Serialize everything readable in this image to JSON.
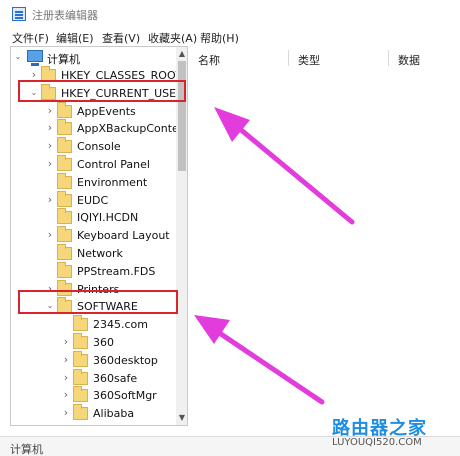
{
  "window": {
    "title": "注册表编辑器"
  },
  "menu": [
    "文件(F)",
    "编辑(E)",
    "查看(V)",
    "收藏夹(A)",
    "帮助(H)"
  ],
  "tree": {
    "root": "计算机",
    "items": [
      {
        "label": "HKEY_CLASSES_ROOT",
        "state": "collapsed",
        "level": 1
      },
      {
        "label": "HKEY_CURRENT_USER",
        "state": "expanded",
        "level": 1,
        "highlighted": true
      },
      {
        "label": "AppEvents",
        "state": "collapsed",
        "level": 2
      },
      {
        "label": "AppXBackupConter",
        "state": "collapsed",
        "level": 2
      },
      {
        "label": "Console",
        "state": "collapsed",
        "level": 2
      },
      {
        "label": "Control Panel",
        "state": "collapsed",
        "level": 2
      },
      {
        "label": "Environment",
        "state": "leaf",
        "level": 2
      },
      {
        "label": "EUDC",
        "state": "collapsed",
        "level": 2
      },
      {
        "label": "IQIYI.HCDN",
        "state": "leaf",
        "level": 2
      },
      {
        "label": "Keyboard Layout",
        "state": "collapsed",
        "level": 2
      },
      {
        "label": "Network",
        "state": "leaf",
        "level": 2
      },
      {
        "label": "PPStream.FDS",
        "state": "leaf",
        "level": 2
      },
      {
        "label": "Printers",
        "state": "collapsed",
        "level": 2
      },
      {
        "label": "SOFTWARE",
        "state": "expanded",
        "level": 2,
        "highlighted": true
      },
      {
        "label": "2345.com",
        "state": "leaf",
        "level": 3
      },
      {
        "label": "360",
        "state": "collapsed",
        "level": 3
      },
      {
        "label": "360desktop",
        "state": "collapsed",
        "level": 3
      },
      {
        "label": "360safe",
        "state": "collapsed",
        "level": 3
      },
      {
        "label": "360SoftMgr",
        "state": "collapsed",
        "level": 3
      },
      {
        "label": "Alibaba",
        "state": "collapsed",
        "level": 3
      }
    ]
  },
  "columns": [
    "名称",
    "类型",
    "数据"
  ],
  "status": "计算机",
  "watermark": {
    "name": "路由器之家",
    "url": "LUYOUQI520.COM"
  },
  "colors": {
    "highlight": "#d9232d",
    "arrow": "#e23ddc",
    "folder": "#f5d77a",
    "watermark": "#1f8de0"
  }
}
